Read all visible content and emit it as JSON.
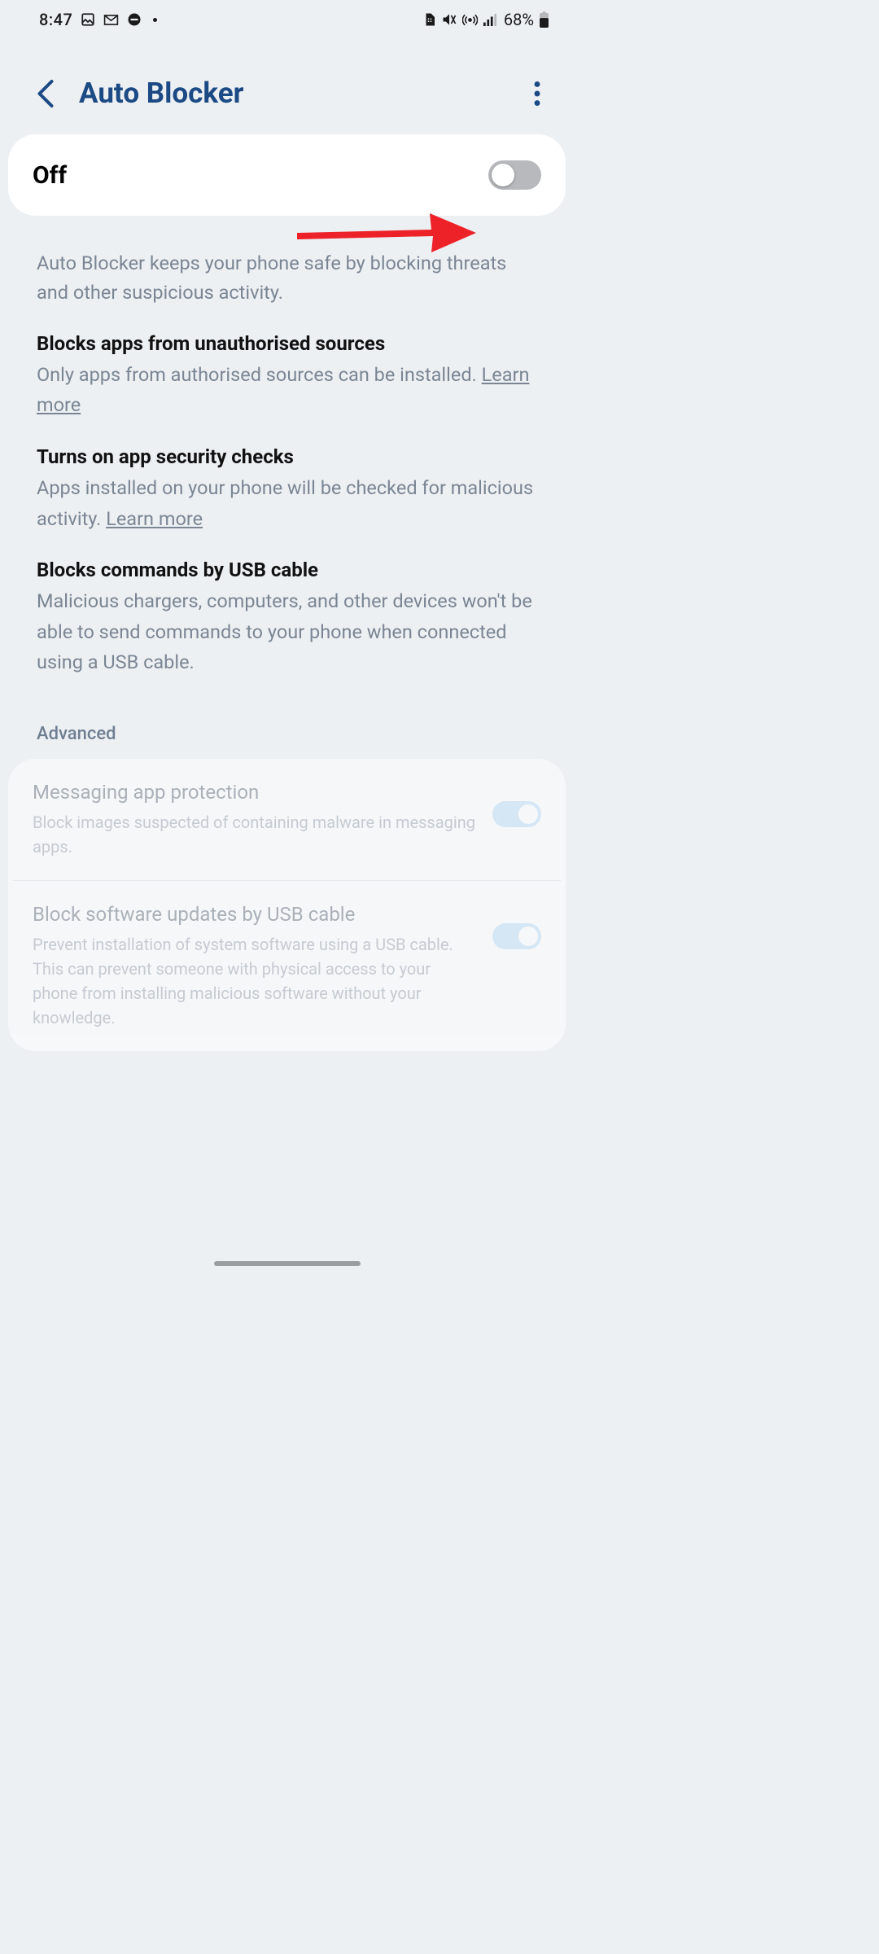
{
  "status_bar": {
    "time": "8:47",
    "battery_pct": "68%",
    "icons": {
      "pic": "image-icon",
      "gmail": "gmail-icon",
      "dnd": "dnd-icon",
      "dot": "dot",
      "sim": "sim-icon",
      "mute": "mute-icon",
      "hotspot": "hotspot-icon",
      "signal": "signal-icon",
      "battery": "battery-icon"
    }
  },
  "header": {
    "title": "Auto Blocker"
  },
  "main_toggle": {
    "state_label": "Off",
    "enabled": false
  },
  "intro": "Auto Blocker keeps your phone safe by blocking threats and other suspicious activity.",
  "features": [
    {
      "title": "Blocks apps from unauthorised sources",
      "desc": "Only apps from authorised sources can be installed. ",
      "learn_more": "Learn more"
    },
    {
      "title": "Turns on app security checks",
      "desc": "Apps installed on your phone will be checked for malicious activity. ",
      "learn_more": "Learn more"
    },
    {
      "title": "Blocks commands by USB cable",
      "desc": "Malicious chargers, computers, and other devices won't be able to send commands to your phone when connected using a USB cable."
    }
  ],
  "advanced_label": "Advanced",
  "advanced_items": [
    {
      "title": "Messaging app protection",
      "desc": "Block images suspected of containing malware in messaging apps.",
      "enabled": true
    },
    {
      "title": "Block software updates by USB cable",
      "desc": "Prevent installation of system software using a USB cable. This can prevent someone with physical access to your phone from installing malicious software without your knowledge.",
      "enabled": true
    }
  ],
  "annotation": {
    "visible": true
  }
}
